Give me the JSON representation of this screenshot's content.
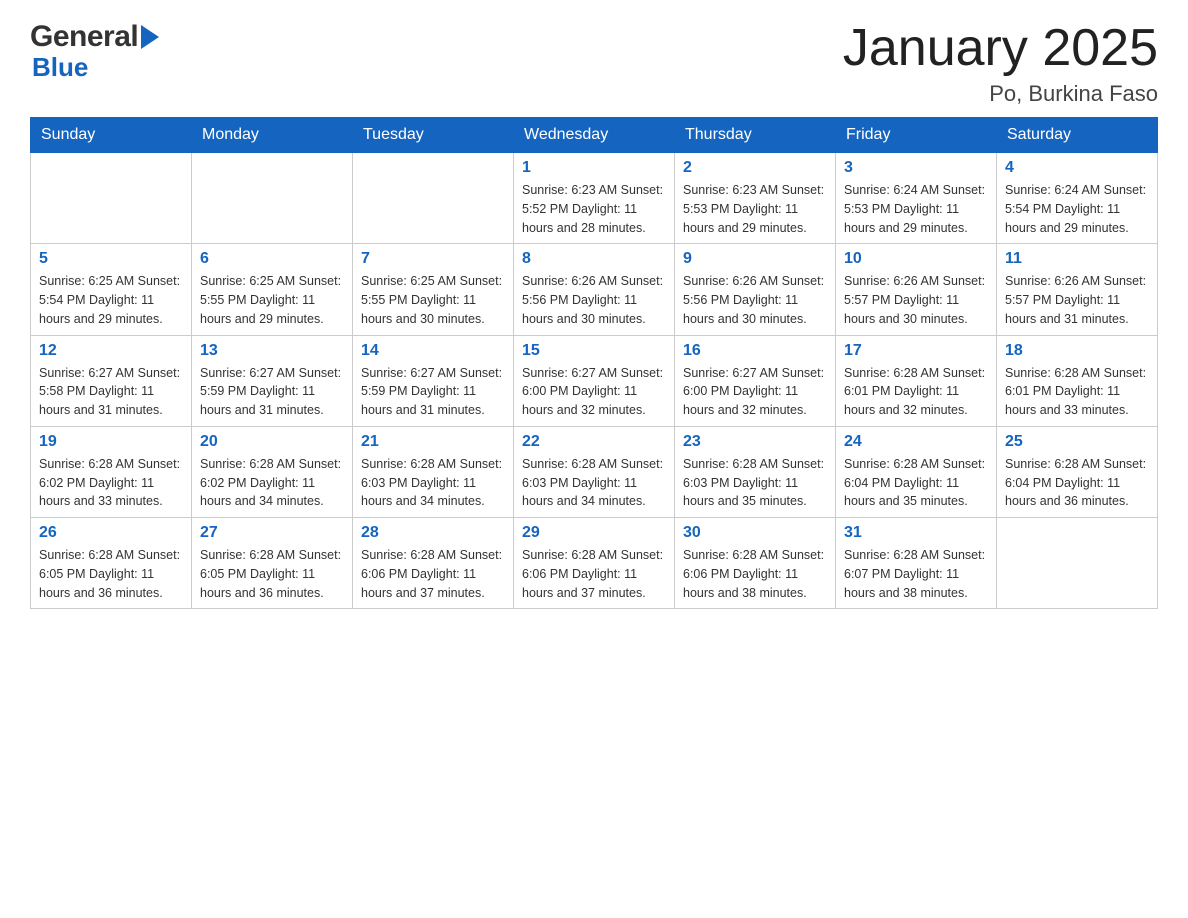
{
  "header": {
    "logo_general": "General",
    "logo_blue": "Blue",
    "title": "January 2025",
    "subtitle": "Po, Burkina Faso"
  },
  "weekdays": [
    "Sunday",
    "Monday",
    "Tuesday",
    "Wednesday",
    "Thursday",
    "Friday",
    "Saturday"
  ],
  "weeks": [
    [
      {
        "day": "",
        "info": ""
      },
      {
        "day": "",
        "info": ""
      },
      {
        "day": "",
        "info": ""
      },
      {
        "day": "1",
        "info": "Sunrise: 6:23 AM\nSunset: 5:52 PM\nDaylight: 11 hours and 28 minutes."
      },
      {
        "day": "2",
        "info": "Sunrise: 6:23 AM\nSunset: 5:53 PM\nDaylight: 11 hours and 29 minutes."
      },
      {
        "day": "3",
        "info": "Sunrise: 6:24 AM\nSunset: 5:53 PM\nDaylight: 11 hours and 29 minutes."
      },
      {
        "day": "4",
        "info": "Sunrise: 6:24 AM\nSunset: 5:54 PM\nDaylight: 11 hours and 29 minutes."
      }
    ],
    [
      {
        "day": "5",
        "info": "Sunrise: 6:25 AM\nSunset: 5:54 PM\nDaylight: 11 hours and 29 minutes."
      },
      {
        "day": "6",
        "info": "Sunrise: 6:25 AM\nSunset: 5:55 PM\nDaylight: 11 hours and 29 minutes."
      },
      {
        "day": "7",
        "info": "Sunrise: 6:25 AM\nSunset: 5:55 PM\nDaylight: 11 hours and 30 minutes."
      },
      {
        "day": "8",
        "info": "Sunrise: 6:26 AM\nSunset: 5:56 PM\nDaylight: 11 hours and 30 minutes."
      },
      {
        "day": "9",
        "info": "Sunrise: 6:26 AM\nSunset: 5:56 PM\nDaylight: 11 hours and 30 minutes."
      },
      {
        "day": "10",
        "info": "Sunrise: 6:26 AM\nSunset: 5:57 PM\nDaylight: 11 hours and 30 minutes."
      },
      {
        "day": "11",
        "info": "Sunrise: 6:26 AM\nSunset: 5:57 PM\nDaylight: 11 hours and 31 minutes."
      }
    ],
    [
      {
        "day": "12",
        "info": "Sunrise: 6:27 AM\nSunset: 5:58 PM\nDaylight: 11 hours and 31 minutes."
      },
      {
        "day": "13",
        "info": "Sunrise: 6:27 AM\nSunset: 5:59 PM\nDaylight: 11 hours and 31 minutes."
      },
      {
        "day": "14",
        "info": "Sunrise: 6:27 AM\nSunset: 5:59 PM\nDaylight: 11 hours and 31 minutes."
      },
      {
        "day": "15",
        "info": "Sunrise: 6:27 AM\nSunset: 6:00 PM\nDaylight: 11 hours and 32 minutes."
      },
      {
        "day": "16",
        "info": "Sunrise: 6:27 AM\nSunset: 6:00 PM\nDaylight: 11 hours and 32 minutes."
      },
      {
        "day": "17",
        "info": "Sunrise: 6:28 AM\nSunset: 6:01 PM\nDaylight: 11 hours and 32 minutes."
      },
      {
        "day": "18",
        "info": "Sunrise: 6:28 AM\nSunset: 6:01 PM\nDaylight: 11 hours and 33 minutes."
      }
    ],
    [
      {
        "day": "19",
        "info": "Sunrise: 6:28 AM\nSunset: 6:02 PM\nDaylight: 11 hours and 33 minutes."
      },
      {
        "day": "20",
        "info": "Sunrise: 6:28 AM\nSunset: 6:02 PM\nDaylight: 11 hours and 34 minutes."
      },
      {
        "day": "21",
        "info": "Sunrise: 6:28 AM\nSunset: 6:03 PM\nDaylight: 11 hours and 34 minutes."
      },
      {
        "day": "22",
        "info": "Sunrise: 6:28 AM\nSunset: 6:03 PM\nDaylight: 11 hours and 34 minutes."
      },
      {
        "day": "23",
        "info": "Sunrise: 6:28 AM\nSunset: 6:03 PM\nDaylight: 11 hours and 35 minutes."
      },
      {
        "day": "24",
        "info": "Sunrise: 6:28 AM\nSunset: 6:04 PM\nDaylight: 11 hours and 35 minutes."
      },
      {
        "day": "25",
        "info": "Sunrise: 6:28 AM\nSunset: 6:04 PM\nDaylight: 11 hours and 36 minutes."
      }
    ],
    [
      {
        "day": "26",
        "info": "Sunrise: 6:28 AM\nSunset: 6:05 PM\nDaylight: 11 hours and 36 minutes."
      },
      {
        "day": "27",
        "info": "Sunrise: 6:28 AM\nSunset: 6:05 PM\nDaylight: 11 hours and 36 minutes."
      },
      {
        "day": "28",
        "info": "Sunrise: 6:28 AM\nSunset: 6:06 PM\nDaylight: 11 hours and 37 minutes."
      },
      {
        "day": "29",
        "info": "Sunrise: 6:28 AM\nSunset: 6:06 PM\nDaylight: 11 hours and 37 minutes."
      },
      {
        "day": "30",
        "info": "Sunrise: 6:28 AM\nSunset: 6:06 PM\nDaylight: 11 hours and 38 minutes."
      },
      {
        "day": "31",
        "info": "Sunrise: 6:28 AM\nSunset: 6:07 PM\nDaylight: 11 hours and 38 minutes."
      },
      {
        "day": "",
        "info": ""
      }
    ]
  ]
}
